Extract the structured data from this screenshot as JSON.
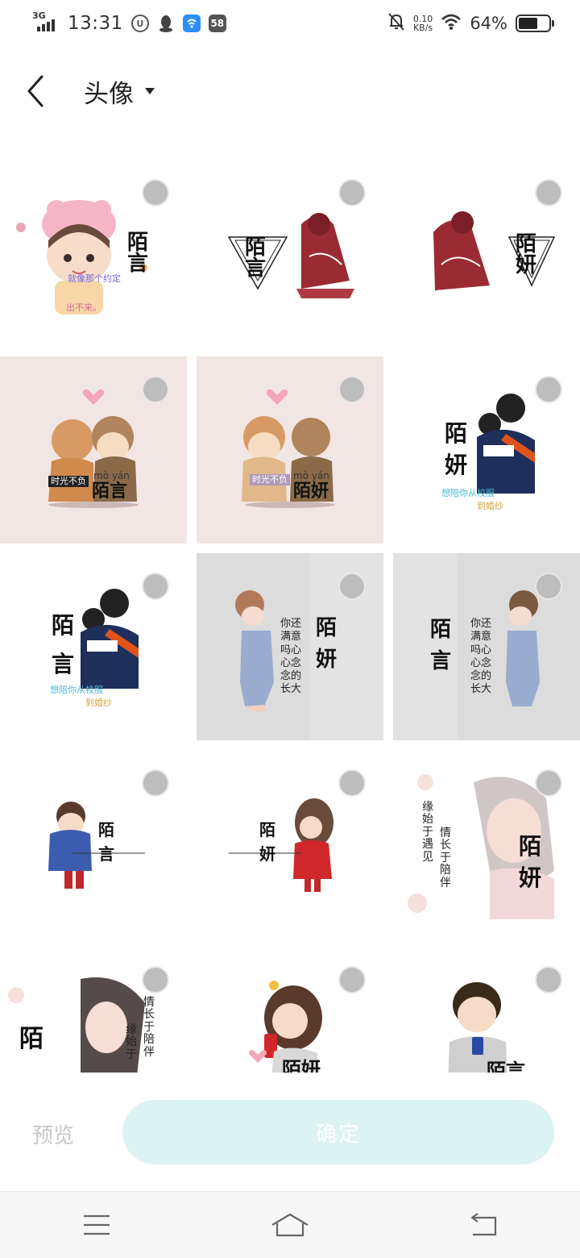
{
  "status_bar": {
    "network": "3G",
    "time": "13:31",
    "notif_badge": "58",
    "speed_value": "0.10",
    "speed_unit": "KB/s",
    "battery_pct": "64%",
    "battery_level": 0.64,
    "icons": [
      "signal-icon",
      "data-saver-icon",
      "qq-icon",
      "wifi-hotspot-app-icon",
      "app-58-icon",
      "silent-bell-icon",
      "wifi-icon",
      "battery-icon"
    ]
  },
  "header": {
    "title": "头像",
    "back_icon": "chevron-left-icon",
    "dropdown_icon": "caret-down-icon"
  },
  "grid": {
    "items": [
      {
        "text": "陌言",
        "sub1": "就像那个约定",
        "sub2": "出不来。"
      },
      {
        "text": "陌言"
      },
      {
        "text": "陌妍"
      },
      {
        "text": "陌言",
        "tag": "时光不负",
        "pinyin": "mò yán"
      },
      {
        "text": "陌妍",
        "tag": "时光不负",
        "pinyin": "mò yán"
      },
      {
        "text": "陌妍",
        "sub1": "想陪你从校服",
        "sub2": "到婚纱"
      },
      {
        "text": "陌言",
        "sub1": "想陪你从校服",
        "sub2": "到婚纱"
      },
      {
        "text": "陌妍",
        "side": "你还满意吗心心念念的长大"
      },
      {
        "text": "陌言",
        "side": "你还满意吗心心念念的长大"
      },
      {
        "text": "陌言"
      },
      {
        "text": "陌妍"
      },
      {
        "text": "陌妍",
        "side1": "缘始于遇见",
        "side2": "情长于陪伴"
      },
      {
        "text": "陌",
        "side1": "情长于陪伴",
        "side2": "缘始于"
      },
      {
        "text": "陌妍"
      },
      {
        "text": "陌言"
      }
    ]
  },
  "actions": {
    "preview": "预览",
    "confirm": "确定"
  },
  "nav": {
    "menu_icon": "menu-icon",
    "home_icon": "home-icon",
    "back_icon": "back-icon"
  },
  "colors": {
    "accent_disabled": "#dcf3f4",
    "check_circle": "#bdbdbd"
  }
}
